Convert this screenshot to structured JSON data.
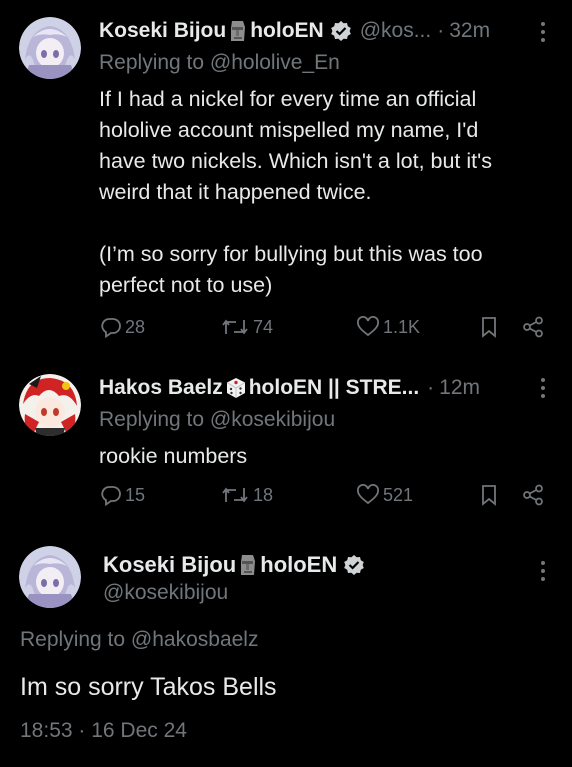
{
  "tweets": [
    {
      "name_part1": "Koseki Bijou",
      "name_part2": "holoEN",
      "handle": "@kos...",
      "dot": "·",
      "time": "32m",
      "replying_prefix": "Replying to",
      "replying_handle": "@hololive_En",
      "text": "If I had a nickel for every time an official\nhololive account mispelled my name, I'd\nhave two nickels. Which isn't a lot, but it's\nweird that it happened twice.\n\n(I’m so sorry for bullying but this was too\nperfect not to use)",
      "replies": "28",
      "retweets": "74",
      "likes": "1.1K"
    },
    {
      "name_part1": "Hakos Baelz",
      "name_part2": "holoEN || STRE...",
      "dot": "·",
      "time": "12m",
      "replying_prefix": "Replying to",
      "replying_handle": "@kosekibijou",
      "text": "rookie numbers",
      "replies": "15",
      "retweets": "18",
      "likes": "521"
    }
  ],
  "main_tweet": {
    "name_part1": "Koseki Bijou",
    "name_part2": "holoEN",
    "handle": "@kosekibijou",
    "replying_prefix": "Replying to",
    "replying_handle": "@hakosbaelz",
    "text": "Im so sorry Takos Bells",
    "timestamp": "18:53 · 16 Dec 24"
  },
  "colors": {
    "background": "#000000",
    "text": "#e7e9ea",
    "muted": "#71767b"
  }
}
